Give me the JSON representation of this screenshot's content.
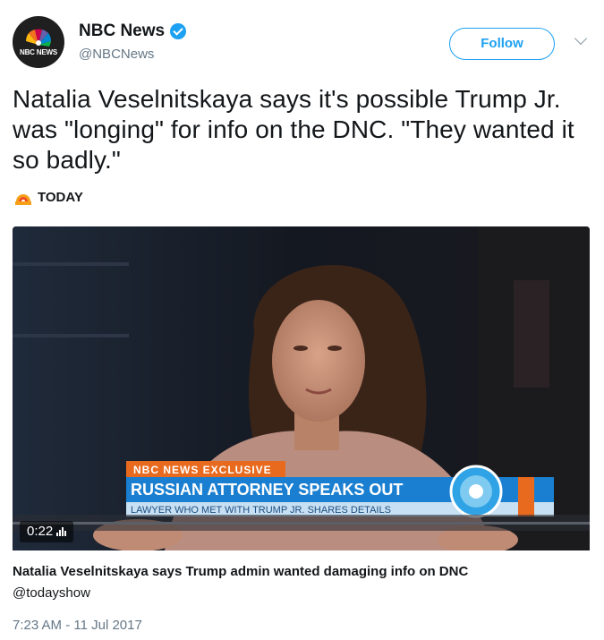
{
  "account": {
    "display_name": "NBC News",
    "handle": "@NBCNews",
    "avatar_label": "NBC NEWS",
    "verified": true
  },
  "follow_label": "Follow",
  "tweet_text": "Natalia Veselnitskaya says it's possible Trump Jr. was \"longing\" for info on the DNC. \"They wanted it so badly.\"",
  "source": {
    "name": "TODAY",
    "logo_label": "TODAY"
  },
  "video": {
    "chyron_tag": "NBC NEWS EXCLUSIVE",
    "headline": "RUSSIAN ATTORNEY SPEAKS OUT",
    "subline": "LAWYER WHO MET WITH TRUMP JR. SHARES DETAILS",
    "duration": "0:22"
  },
  "card": {
    "title": "Natalia Veselnitskaya says Trump admin wanted damaging info on DNC",
    "domain": "@todayshow"
  },
  "timestamp": "7:23 AM - 11 Jul 2017",
  "colors": {
    "accent": "#1da1f2",
    "chyron_blue": "#1a7fd1",
    "chyron_orange": "#e86a1e"
  }
}
